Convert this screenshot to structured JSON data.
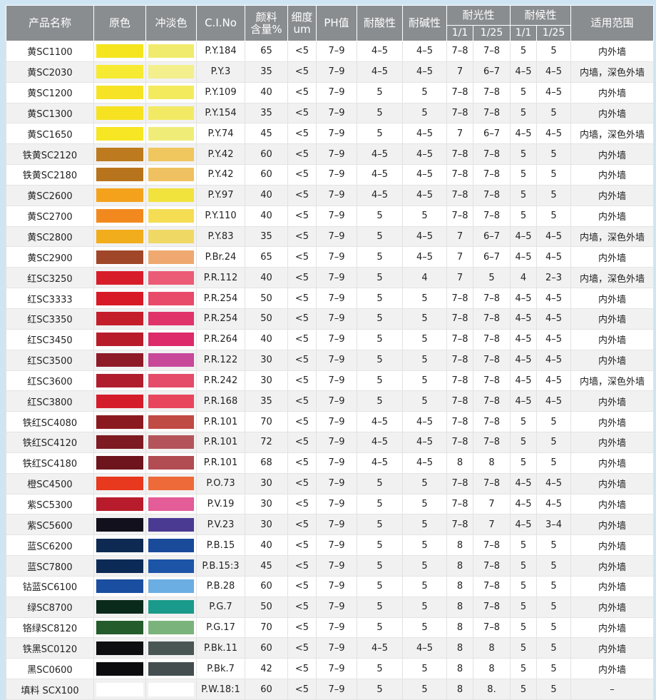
{
  "headers": {
    "name": "产品名称",
    "mass": "原色",
    "tint": "冲淡色",
    "ci": "C.I.No",
    "content": [
      "颜料",
      "含量%"
    ],
    "fineness": [
      "细度",
      "um"
    ],
    "ph": "PH值",
    "acid": "耐酸性",
    "alkali": "耐碱性",
    "light": "耐光性",
    "weather": "耐候性",
    "light_1_1": "1/1",
    "light_1_25": "1/25",
    "weather_1_1": "1/1",
    "weather_1_25": "1/25",
    "use": "适用范围"
  },
  "rows": [
    {
      "name": "黄SC1100",
      "mass": "#f5e51f",
      "tint": "#f0eb6c",
      "ci": "P.Y.184",
      "content": "65",
      "fineness": "<5",
      "ph": "7–9",
      "acid": "4–5",
      "alkali": "4–5",
      "l1": "7–8",
      "l25": "7–8",
      "w1": "5",
      "w25": "5",
      "use": "内外墙"
    },
    {
      "name": "黄SC2030",
      "mass": "#f6ea32",
      "tint": "#f3ef8c",
      "ci": "P.Y.3",
      "content": "35",
      "fineness": "<5",
      "ph": "7–9",
      "acid": "4–5",
      "alkali": "4–5",
      "l1": "7",
      "l25": "6–7",
      "w1": "4–5",
      "w25": "4–5",
      "use": "内墙，深色外墙"
    },
    {
      "name": "黄SC1200",
      "mass": "#f6e326",
      "tint": "#f4ea5e",
      "ci": "P.Y.109",
      "content": "40",
      "fineness": "<5",
      "ph": "7–9",
      "acid": "5",
      "alkali": "5",
      "l1": "7–8",
      "l25": "7–8",
      "w1": "5",
      "w25": "4–5",
      "use": "内外墙"
    },
    {
      "name": "黄SC1300",
      "mass": "#f6e221",
      "tint": "#f2ea64",
      "ci": "P.Y.154",
      "content": "35",
      "fineness": "<5",
      "ph": "7–9",
      "acid": "5",
      "alkali": "5",
      "l1": "7–8",
      "l25": "7–8",
      "w1": "5",
      "w25": "5",
      "use": "内外墙"
    },
    {
      "name": "黄SC1650",
      "mass": "#f6e623",
      "tint": "#f0ec78",
      "ci": "P.Y.74",
      "content": "45",
      "fineness": "<5",
      "ph": "7–9",
      "acid": "5",
      "alkali": "4–5",
      "l1": "7",
      "l25": "6–7",
      "w1": "4–5",
      "w25": "4–5",
      "use": "内墙，深色外墙"
    },
    {
      "name": "铁黄SC2120",
      "mass": "#bd7a1e",
      "tint": "#f0c65e",
      "ci": "P.Y.42",
      "content": "60",
      "fineness": "<5",
      "ph": "7–9",
      "acid": "4–5",
      "alkali": "4–5",
      "l1": "7–8",
      "l25": "7–8",
      "w1": "5",
      "w25": "5",
      "use": "内外墙"
    },
    {
      "name": "铁黄SC2180",
      "mass": "#b8741d",
      "tint": "#efc160",
      "ci": "P.Y.42",
      "content": "60",
      "fineness": "<5",
      "ph": "7–9",
      "acid": "4–5",
      "alkali": "4–5",
      "l1": "7–8",
      "l25": "7–8",
      "w1": "5",
      "w25": "5",
      "use": "内外墙"
    },
    {
      "name": "黄SC2600",
      "mass": "#f4a21c",
      "tint": "#f2e23c",
      "ci": "P.Y.97",
      "content": "40",
      "fineness": "<5",
      "ph": "7–9",
      "acid": "4–5",
      "alkali": "4–5",
      "l1": "7–8",
      "l25": "7–8",
      "w1": "5",
      "w25": "5",
      "use": "内外墙"
    },
    {
      "name": "黄SC2700",
      "mass": "#f2891e",
      "tint": "#f4dd52",
      "ci": "P.Y.110",
      "content": "40",
      "fineness": "<5",
      "ph": "7–9",
      "acid": "5",
      "alkali": "5",
      "l1": "7–8",
      "l25": "7–8",
      "w1": "5",
      "w25": "5",
      "use": "内外墙"
    },
    {
      "name": "黄SC2800",
      "mass": "#f2ad1c",
      "tint": "#f0d864",
      "ci": "P.Y.83",
      "content": "35",
      "fineness": "<5",
      "ph": "7–9",
      "acid": "5",
      "alkali": "4–5",
      "l1": "7",
      "l25": "6–7",
      "w1": "4–5",
      "w25": "4–5",
      "use": "内墙，深色外墙"
    },
    {
      "name": "黄SC2900",
      "mass": "#a0472a",
      "tint": "#eea870",
      "ci": "P.Br.24",
      "content": "65",
      "fineness": "<5",
      "ph": "7–9",
      "acid": "5",
      "alkali": "4–5",
      "l1": "7",
      "l25": "6–7",
      "w1": "4–5",
      "w25": "4–5",
      "use": "内外墙"
    },
    {
      "name": "红SC3250",
      "mass": "#d81d2a",
      "tint": "#ec5b76",
      "ci": "P.R.112",
      "content": "40",
      "fineness": "<5",
      "ph": "7–9",
      "acid": "5",
      "alkali": "4",
      "l1": "7",
      "l25": "5",
      "w1": "4",
      "w25": "2–3",
      "use": "内墙，深色外墙"
    },
    {
      "name": "红SC3333",
      "mass": "#d81a26",
      "tint": "#e84a6a",
      "ci": "P.R.254",
      "content": "50",
      "fineness": "<5",
      "ph": "7–9",
      "acid": "5",
      "alkali": "5",
      "l1": "7–8",
      "l25": "7–8",
      "w1": "4–5",
      "w25": "4–5",
      "use": "内外墙"
    },
    {
      "name": "红SC3350",
      "mass": "#c41e2a",
      "tint": "#e0336a",
      "ci": "P.R.254",
      "content": "50",
      "fineness": "<5",
      "ph": "7–9",
      "acid": "5",
      "alkali": "5",
      "l1": "7–8",
      "l25": "7–8",
      "w1": "4–5",
      "w25": "4–5",
      "use": "内外墙"
    },
    {
      "name": "红SC3450",
      "mass": "#b81c2a",
      "tint": "#dc2a6a",
      "ci": "P.R.264",
      "content": "40",
      "fineness": "<5",
      "ph": "7–9",
      "acid": "5",
      "alkali": "5",
      "l1": "7–8",
      "l25": "7–8",
      "w1": "4–5",
      "w25": "4–5",
      "use": "内外墙"
    },
    {
      "name": "红SC3500",
      "mass": "#8e1a28",
      "tint": "#c8489a",
      "ci": "P.R.122",
      "content": "30",
      "fineness": "<5",
      "ph": "7–9",
      "acid": "5",
      "alkali": "5",
      "l1": "7–8",
      "l25": "7–8",
      "w1": "4–5",
      "w25": "4–5",
      "use": "内外墙"
    },
    {
      "name": "红SC3600",
      "mass": "#b01e2e",
      "tint": "#e44c6a",
      "ci": "P.R.242",
      "content": "30",
      "fineness": "<5",
      "ph": "7–9",
      "acid": "5",
      "alkali": "5",
      "l1": "7–8",
      "l25": "7–8",
      "w1": "4–5",
      "w25": "4–5",
      "use": "内墙，深色外墙"
    },
    {
      "name": "红SC3800",
      "mass": "#d41c2a",
      "tint": "#e8465c",
      "ci": "P.R.168",
      "content": "35",
      "fineness": "<5",
      "ph": "7–9",
      "acid": "5",
      "alkali": "5",
      "l1": "7–8",
      "l25": "7–8",
      "w1": "4–5",
      "w25": "4–5",
      "use": "内外墙"
    },
    {
      "name": "铁红SC4080",
      "mass": "#8a1a20",
      "tint": "#c04a44",
      "ci": "P.R.101",
      "content": "70",
      "fineness": "<5",
      "ph": "7–9",
      "acid": "4–5",
      "alkali": "4–5",
      "l1": "7–8",
      "l25": "7–8",
      "w1": "5",
      "w25": "5",
      "use": "内外墙"
    },
    {
      "name": "铁红SC4120",
      "mass": "#7e1a22",
      "tint": "#b4545a",
      "ci": "P.R.101",
      "content": "72",
      "fineness": "<5",
      "ph": "7–9",
      "acid": "4–5",
      "alkali": "4–5",
      "l1": "7–8",
      "l25": "7–8",
      "w1": "5",
      "w25": "5",
      "use": "内外墙"
    },
    {
      "name": "铁红SC4180",
      "mass": "#6e141c",
      "tint": "#b04c52",
      "ci": "P.R.101",
      "content": "68",
      "fineness": "<5",
      "ph": "7–9",
      "acid": "4–5",
      "alkali": "4–5",
      "l1": "8",
      "l25": "8",
      "w1": "5",
      "w25": "5",
      "use": "内外墙"
    },
    {
      "name": "橙SC4500",
      "mass": "#e8381e",
      "tint": "#ee6a38",
      "ci": "P.O.73",
      "content": "30",
      "fineness": "<5",
      "ph": "7–9",
      "acid": "5",
      "alkali": "5",
      "l1": "7–8",
      "l25": "7–8",
      "w1": "4–5",
      "w25": "4–5",
      "use": "内外墙"
    },
    {
      "name": "紫SC5300",
      "mass": "#b81c2c",
      "tint": "#e45c98",
      "ci": "P.V.19",
      "content": "30",
      "fineness": "<5",
      "ph": "7–9",
      "acid": "5",
      "alkali": "5",
      "l1": "7–8",
      "l25": "7",
      "w1": "4–5",
      "w25": "4–5",
      "use": "内外墙"
    },
    {
      "name": "紫SC5600",
      "mass": "#12101c",
      "tint": "#4a3a92",
      "ci": "P.V.23",
      "content": "30",
      "fineness": "<5",
      "ph": "7–9",
      "acid": "5",
      "alkali": "5",
      "l1": "7–8",
      "l25": "7",
      "w1": "4–5",
      "w25": "3–4",
      "use": "内外墙"
    },
    {
      "name": "蓝SC6200",
      "mass": "#0e2a52",
      "tint": "#1a4a9a",
      "ci": "P.B.15",
      "content": "40",
      "fineness": "<5",
      "ph": "7–9",
      "acid": "5",
      "alkali": "5",
      "l1": "8",
      "l25": "7–8",
      "w1": "5",
      "w25": "5",
      "use": "内外墙"
    },
    {
      "name": "蓝SC7800",
      "mass": "#0c2a56",
      "tint": "#1c54a8",
      "ci": "P.B.15:3",
      "content": "45",
      "fineness": "<5",
      "ph": "7–9",
      "acid": "5",
      "alkali": "5",
      "l1": "8",
      "l25": "7–8",
      "w1": "5",
      "w25": "5",
      "use": "内外墙"
    },
    {
      "name": "钴蓝SC6100",
      "mass": "#1a4ea0",
      "tint": "#6aaee4",
      "ci": "P.B.28",
      "content": "60",
      "fineness": "<5",
      "ph": "7–9",
      "acid": "5",
      "alkali": "5",
      "l1": "8",
      "l25": "7–8",
      "w1": "5",
      "w25": "5",
      "use": "内外墙"
    },
    {
      "name": "绿SC8700",
      "mass": "#0a2a1c",
      "tint": "#1a9a8a",
      "ci": "P.G.7",
      "content": "50",
      "fineness": "<5",
      "ph": "7–9",
      "acid": "5",
      "alkali": "5",
      "l1": "8",
      "l25": "7–8",
      "w1": "5",
      "w25": "5",
      "use": "内外墙"
    },
    {
      "name": "铬绿SC8120",
      "mass": "#245c2c",
      "tint": "#7ab47c",
      "ci": "P.G.17",
      "content": "70",
      "fineness": "<5",
      "ph": "7–9",
      "acid": "5",
      "alkali": "5",
      "l1": "8",
      "l25": "7–8",
      "w1": "5",
      "w25": "5",
      "use": "内外墙"
    },
    {
      "name": "铁黑SC0120",
      "mass": "#0e0e10",
      "tint": "#4a5654",
      "ci": "P.Bk.11",
      "content": "60",
      "fineness": "<5",
      "ph": "7–9",
      "acid": "4–5",
      "alkali": "4–5",
      "l1": "8",
      "l25": "8",
      "w1": "5",
      "w25": "5",
      "use": "内外墙"
    },
    {
      "name": "黑SC0600",
      "mass": "#0c0c0e",
      "tint": "#444e50",
      "ci": "P.Bk.7",
      "content": "42",
      "fineness": "<5",
      "ph": "7–9",
      "acid": "5",
      "alkali": "5",
      "l1": "8",
      "l25": "8",
      "w1": "5",
      "w25": "5",
      "use": "内外墙"
    },
    {
      "name": "填料 SCX100",
      "mass": "#ffffff",
      "tint": "#ffffff",
      "ci": "P.W.18:1",
      "content": "60",
      "fineness": "<5",
      "ph": "7–9",
      "acid": "5",
      "alkali": "5",
      "l1": "8",
      "l25": "8.",
      "w1": "5",
      "w25": "5",
      "use": "–"
    }
  ]
}
